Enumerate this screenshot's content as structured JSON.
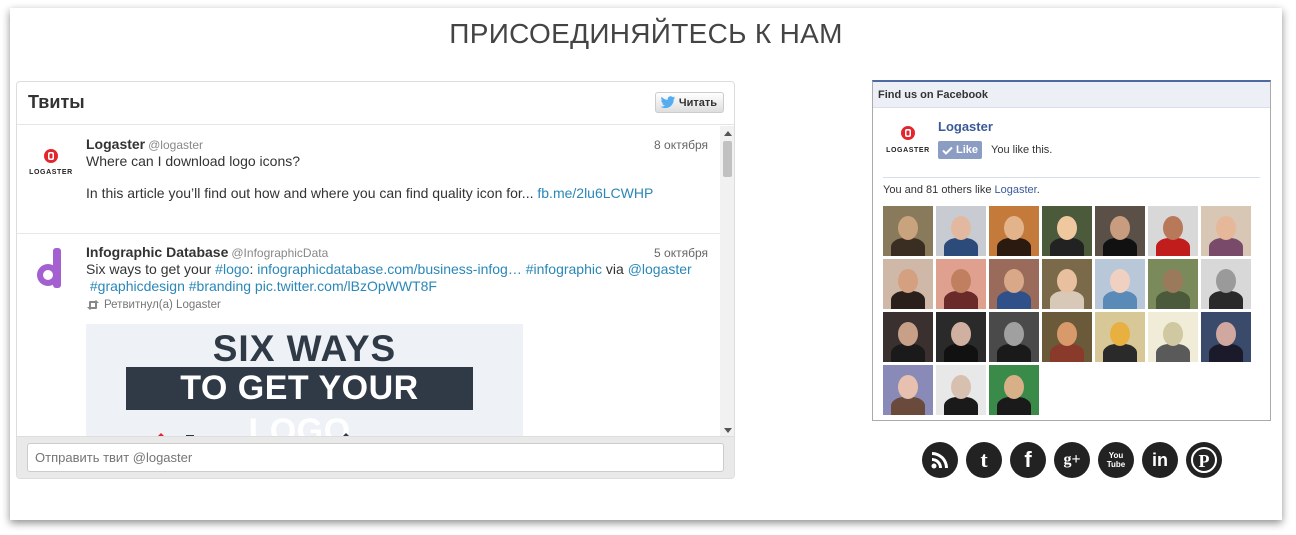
{
  "page_title": "ПРИСОЕДИНЯЙТЕСЬ К НАМ",
  "twitter": {
    "title": "Твиты",
    "follow_label": "Читать",
    "tweets": [
      {
        "name": "Logaster",
        "handle": "@logaster",
        "date": "8 октября",
        "avatar_text": "LOGASTER",
        "text1": "Where can I download logo icons?",
        "text2": "In this article you’ll find out how and where you can find quality icon for... ",
        "link": "fb.me/2lu6LCWHP"
      },
      {
        "name": "Infographic Database",
        "handle": "@InfographicData",
        "date": "5 октября",
        "line1_plain1": "Six ways to get your ",
        "line1_tag1": "#logo",
        "line1_plain2": ": ",
        "line1_url": "infographicdatabase.com/business-infog…",
        "line1_tag2": "#infographic",
        "line1_plain3": " via ",
        "line1_mention": "@logaster",
        "line2_tag1": "#graphicdesign",
        "line2_tag2": "#branding",
        "line2_url": "pic.twitter.com/lBzOpWWT8F",
        "retweeted": "Ретвитнул(а) Logaster",
        "image_line1": "SIX WAYS",
        "image_line2": "TO GET YOUR LOGO"
      }
    ],
    "compose_placeholder": "Отправить твит @logaster"
  },
  "facebook": {
    "header": "Find us on Facebook",
    "page_name": "Logaster",
    "logo_text": "LOGASTER",
    "like_label": "Like",
    "you_like": "You like this.",
    "count_prefix": "You and 81 others like ",
    "count_link": "Logaster",
    "count_suffix": ".",
    "face_count": 24
  },
  "social": [
    {
      "name": "rss-icon",
      "glyph": "rss"
    },
    {
      "name": "twitter-icon",
      "glyph": "t"
    },
    {
      "name": "facebook-icon",
      "glyph": "f"
    },
    {
      "name": "google-plus-icon",
      "glyph": "g+"
    },
    {
      "name": "youtube-icon",
      "glyph": "You Tube"
    },
    {
      "name": "linkedin-icon",
      "glyph": "in"
    },
    {
      "name": "pinterest-icon",
      "glyph": "P"
    }
  ],
  "colors": {
    "link": "#2a87b8",
    "facebook_blue": "#3b5998",
    "logo_red": "#e3262e",
    "social_bg": "#222222"
  }
}
